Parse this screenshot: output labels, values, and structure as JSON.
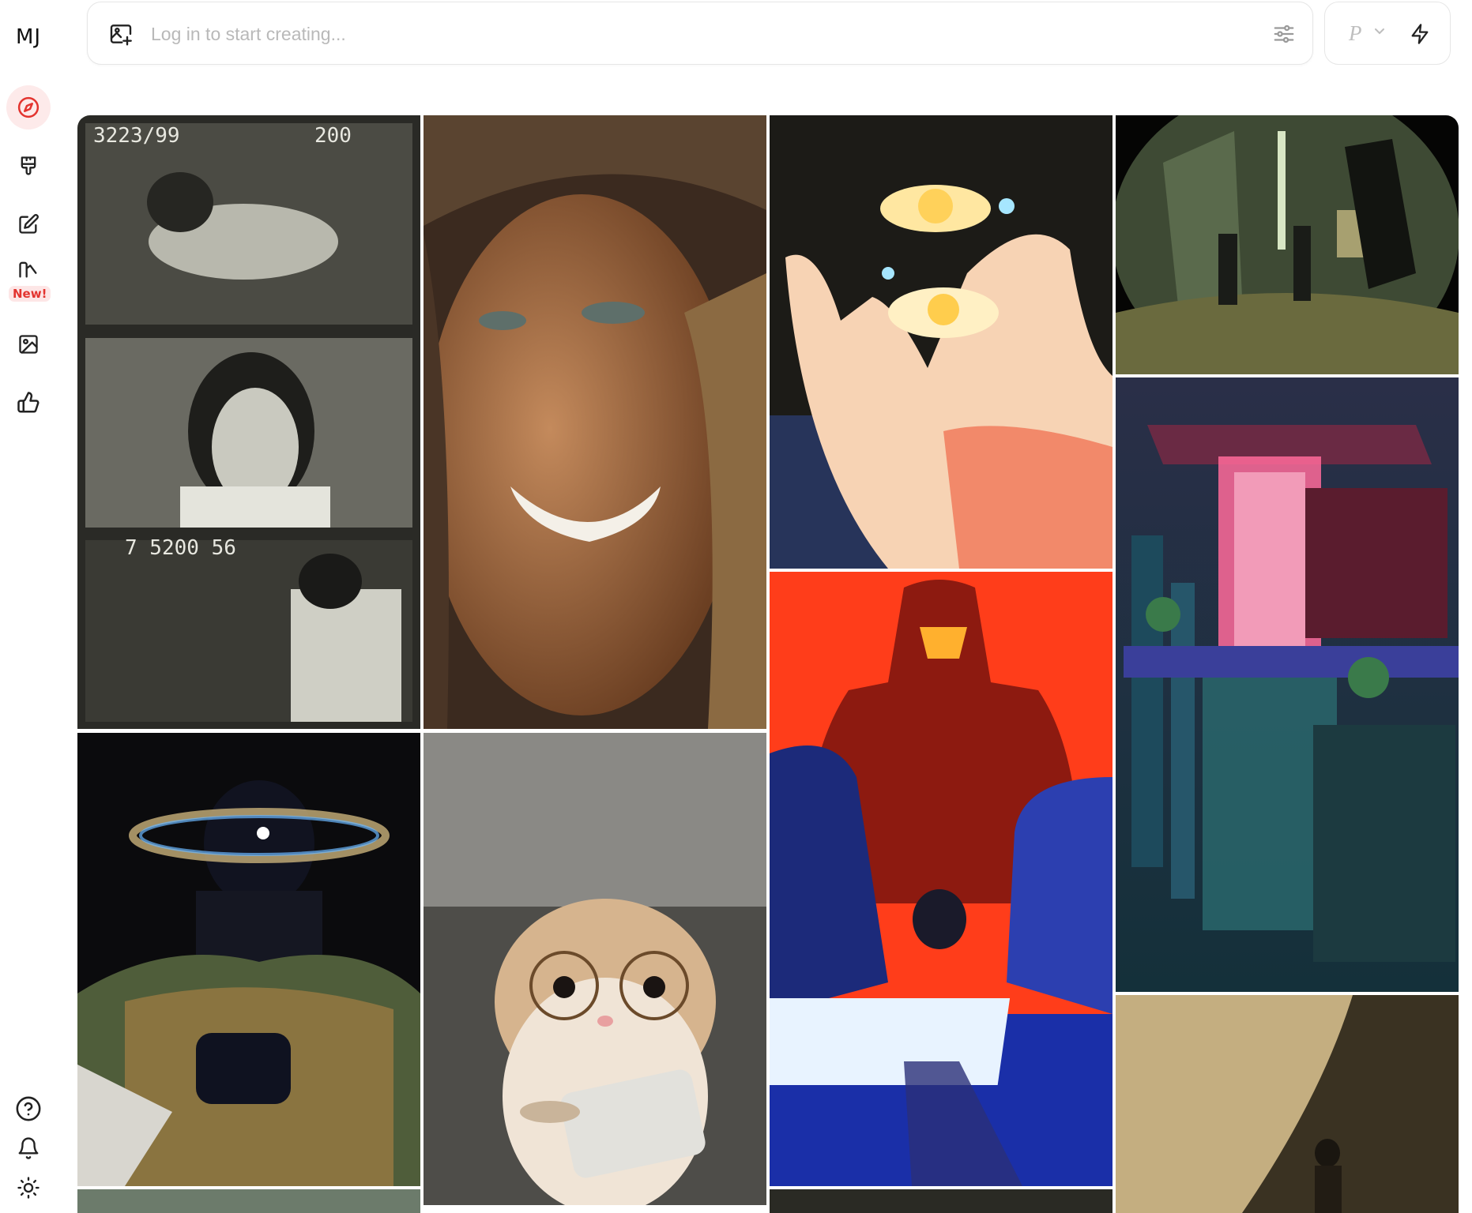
{
  "app": {
    "logo": "MJ"
  },
  "sidebar": {
    "items": [
      {
        "name": "explore",
        "icon": "compass-icon",
        "active": true
      },
      {
        "name": "create",
        "icon": "paintbrush-icon"
      },
      {
        "name": "edit",
        "icon": "edit-icon"
      },
      {
        "name": "personalize",
        "icon": "organize-icon",
        "badge": "New!"
      },
      {
        "name": "gallery",
        "icon": "image-icon"
      },
      {
        "name": "likes",
        "icon": "thumbs-up-icon"
      }
    ],
    "bottom": [
      {
        "name": "help",
        "icon": "help-circle-icon"
      },
      {
        "name": "notifications",
        "icon": "bell-icon"
      },
      {
        "name": "theme",
        "icon": "sun-icon"
      }
    ]
  },
  "prompt": {
    "placeholder": "Log in to start creating...",
    "mode_label": "P"
  },
  "colors": {
    "accent": "#e3342f",
    "accent_bg": "#fdeaea"
  },
  "gallery": {
    "tiles": [
      {
        "name": "gallery-image-film-strip",
        "description": "black and white film frames"
      },
      {
        "name": "gallery-image-smiling-woman",
        "description": "smiling woman with braids"
      },
      {
        "name": "gallery-image-hand-flowers",
        "description": "glowing hand holding flowers"
      },
      {
        "name": "gallery-image-subway-tunnel",
        "description": "fisheye subway tunnel"
      },
      {
        "name": "gallery-image-cosmic-figure",
        "description": "cosmic figure with ring"
      },
      {
        "name": "gallery-image-neon-tower",
        "description": "neon cyberpunk tower"
      },
      {
        "name": "gallery-image-anime-red",
        "description": "anime characters red background"
      },
      {
        "name": "gallery-image-hamster",
        "description": "hamster with glasses"
      },
      {
        "name": "gallery-image-concrete-wall",
        "description": "person by concrete wall"
      }
    ]
  }
}
